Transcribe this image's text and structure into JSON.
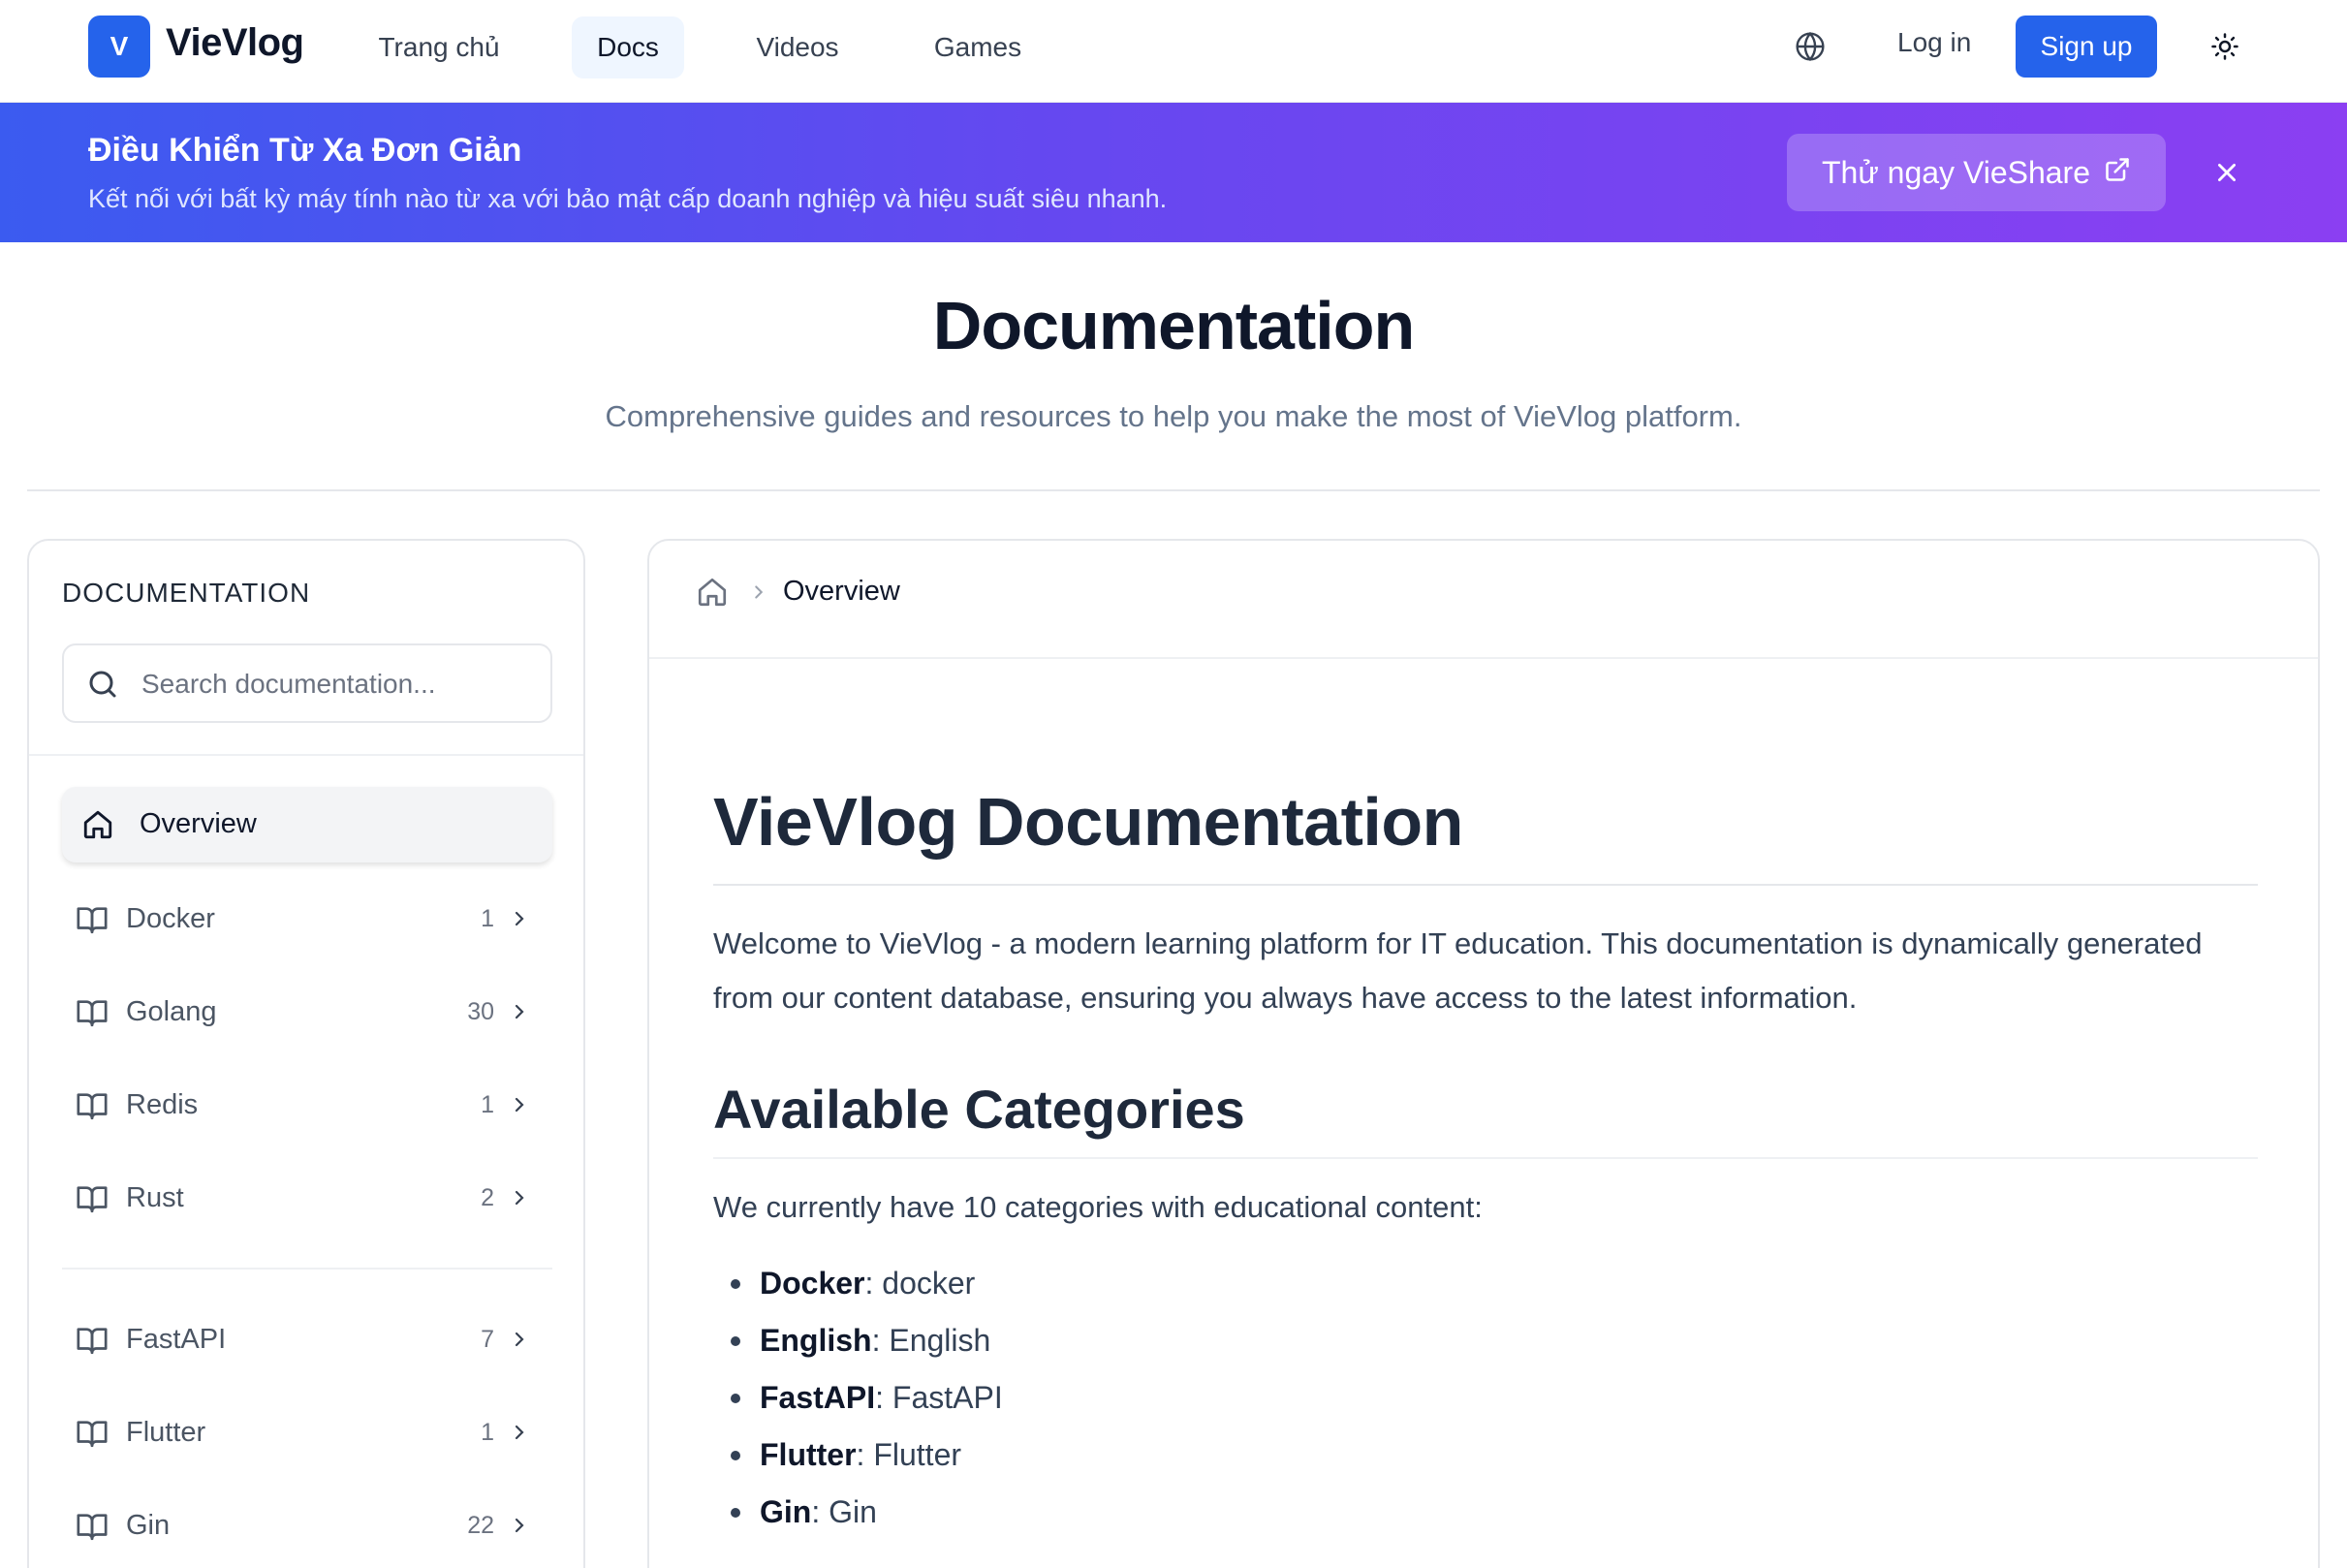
{
  "header": {
    "logo_letter": "V",
    "logo_text": "VieVlog",
    "nav": [
      {
        "label": "Trang chủ",
        "active": false
      },
      {
        "label": "Docs",
        "active": true
      },
      {
        "label": "Videos",
        "active": false
      },
      {
        "label": "Games",
        "active": false
      }
    ],
    "login_label": "Log in",
    "signup_label": "Sign up",
    "icons": {
      "language": "globe-icon",
      "theme": "sun-icon"
    }
  },
  "banner": {
    "title": "Điều Khiển Từ Xa Đơn Giản",
    "subtitle": "Kết nối với bất kỳ máy tính nào từ xa với bảo mật cấp doanh nghiệp và hiệu suất siêu nhanh.",
    "cta_label": "Thử ngay VieShare",
    "cta_icon": "external-link-icon",
    "close_icon": "close-icon"
  },
  "page": {
    "title": "Documentation",
    "subtitle": "Comprehensive guides and resources to help you make the most of VieVlog platform."
  },
  "sidebar": {
    "heading": "DOCUMENTATION",
    "search_placeholder": "Search documentation...",
    "overview_label": "Overview",
    "groups": [
      [
        {
          "label": "Docker",
          "count": "1"
        },
        {
          "label": "Golang",
          "count": "30"
        },
        {
          "label": "Redis",
          "count": "1"
        },
        {
          "label": "Rust",
          "count": "2"
        }
      ],
      [
        {
          "label": "FastAPI",
          "count": "7"
        },
        {
          "label": "Flutter",
          "count": "1"
        },
        {
          "label": "Gin",
          "count": "22"
        }
      ]
    ]
  },
  "main": {
    "breadcrumb": {
      "current": "Overview"
    },
    "h1": "VieVlog Documentation",
    "intro": "Welcome to VieVlog - a modern learning platform for IT education. This documentation is dynamically generated from our content database, ensuring you always have access to the latest information.",
    "h2": "Available Categories",
    "categories_intro": "We currently have 10 categories with educational content:",
    "categories": [
      {
        "name": "Docker",
        "desc": ": docker"
      },
      {
        "name": "English",
        "desc": ": English"
      },
      {
        "name": "FastAPI",
        "desc": ": FastAPI"
      },
      {
        "name": "Flutter",
        "desc": ": Flutter"
      },
      {
        "name": "Gin",
        "desc": ": Gin"
      }
    ]
  },
  "colors": {
    "primary": "#2563eb",
    "banner_start": "#3b5bf0",
    "banner_end": "#8b3ff2"
  }
}
